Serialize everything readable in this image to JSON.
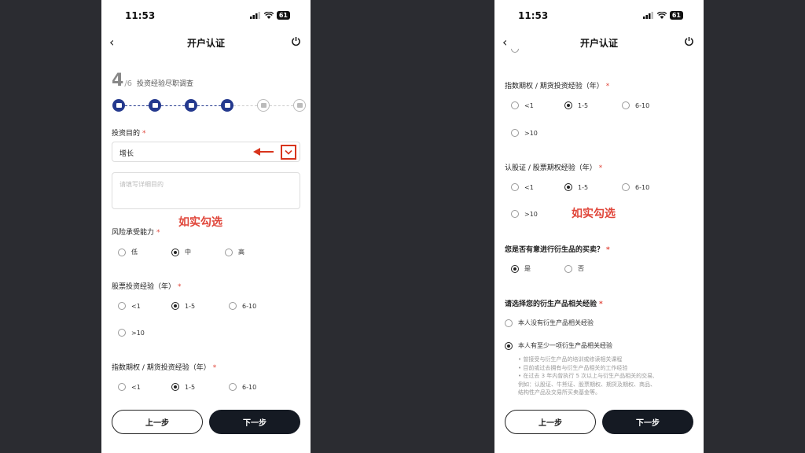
{
  "status_bar": {
    "time": "11:53",
    "battery": "61"
  },
  "nav": {
    "title": "开户认证"
  },
  "step": {
    "current": "4",
    "total": "/6",
    "label": "投资经验尽职调查",
    "progress": {
      "completed": 4,
      "total": 6
    }
  },
  "form": {
    "purpose": {
      "label": "投资目的",
      "required_mark": "*",
      "selected": "增长",
      "detail_placeholder": "请填写详细目的"
    },
    "annotation": "如实勾选",
    "risk": {
      "label": "风险承受能力",
      "required_mark": "*",
      "options": [
        "低",
        "中",
        "高"
      ],
      "selected": "中"
    },
    "stock_exp": {
      "label": "股票投资经验（年）",
      "required_mark": "*",
      "options": [
        "<1",
        "1-5",
        "6-10",
        ">10"
      ],
      "selected": "1-5"
    },
    "index_exp": {
      "label": "指数期权 / 期货投资经验（年）",
      "required_mark": "*",
      "options": [
        "<1",
        "1-5",
        "6-10",
        ">10"
      ],
      "selected": "1-5"
    },
    "warrant_exp": {
      "label": "认股证 / 股票期权经验（年）",
      "required_mark": "*",
      "options": [
        "<1",
        "1-5",
        "6-10",
        ">10"
      ],
      "selected": "1-5"
    },
    "derivative_intent": {
      "label": "您是否有意进行衍生品的买卖？",
      "required_mark": "*",
      "options": [
        "是",
        "否"
      ],
      "selected": "是"
    },
    "derivative_exp": {
      "label": "请选择您的衍生产品相关经验",
      "required_mark": "*",
      "options": [
        "本人没有衍生产品相关经验",
        "本人有至少一项衍生产品相关经验"
      ],
      "selected": "本人有至少一项衍生产品相关经验",
      "details": [
        "• 曾接受与衍生产品的培训或修读相关课程",
        "• 目前或过去拥有与衍生产品相关的工作经验",
        "• 在过去 3 年内曾执行 5 次以上与衍生产品相关的交易,",
        "  例如：认股证、牛熊证、股票期权、期货及期权、商品、",
        "  结构性产品及交易所买卖基金等。"
      ]
    }
  },
  "buttons": {
    "prev": "上一步",
    "next": "下一步"
  },
  "colors": {
    "accent": "#24398e",
    "highlight": "#d8341c",
    "annotation": "#e0463a",
    "primary_button": "#151a23"
  }
}
